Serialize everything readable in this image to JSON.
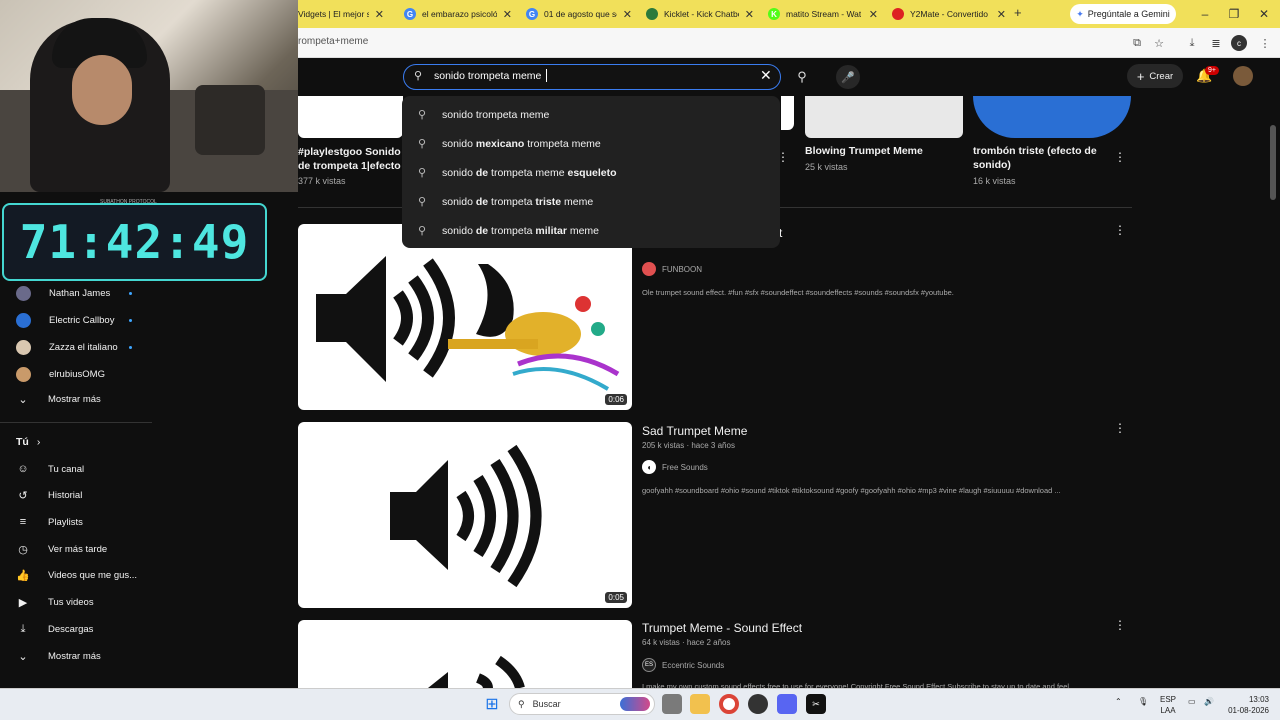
{
  "browser": {
    "tabs": [
      {
        "label": "Vidgets | El mejor so",
        "fav_color": "#e24",
        "fav": ""
      },
      {
        "label": "el embarazo psicológ",
        "fav_color": "#4285f4",
        "fav": "G"
      },
      {
        "label": "01 de agosto que se",
        "fav_color": "#4285f4",
        "fav": "G"
      },
      {
        "label": "Kicklet - Kick Chatbo",
        "fav_color": "#2b7a3b",
        "fav": ""
      },
      {
        "label": "matito Stream - Wat",
        "fav_color": "#53fc18",
        "fav": "K"
      },
      {
        "label": "Y2Mate - Convertido",
        "fav_color": "#d22",
        "fav": ""
      }
    ],
    "new_tab": "+",
    "gemini_label": "Pregúntale a Gemini",
    "url": "rompeta+meme"
  },
  "youtube": {
    "search_value": "sonido trompeta meme",
    "create_label": "Crear",
    "notif_badge": "9+",
    "suggestions": [
      {
        "pre": "sonido ",
        "bold": "",
        "post": "trompeta meme",
        "bold2": ""
      },
      {
        "pre": "sonido ",
        "bold": "mexicano",
        "post": " trompeta meme",
        "bold2": ""
      },
      {
        "pre": "sonido ",
        "bold": "de",
        "post": " trompeta meme ",
        "bold2": "esqueleto"
      },
      {
        "pre": "sonido ",
        "bold": "de",
        "post": " trompeta ",
        "bold2": "triste",
        "post2": " meme"
      },
      {
        "pre": "sonido ",
        "bold": "de",
        "post": " trompeta ",
        "bold2": "militar",
        "post2": " meme"
      }
    ],
    "shorts": [
      {
        "title": "#playlestgoo Sonido de trompeta 1|efecto de ...",
        "views": "377 k vistas"
      },
      {
        "title": "Blowing Trumpet Meme",
        "views": "25 k vistas"
      },
      {
        "title": "trombón triste (efecto de sonido)",
        "views": "16 k vistas"
      }
    ],
    "videos": [
      {
        "title": "t",
        "meta": "",
        "channel": "FUNBOON",
        "desc": "Ole trumpet sound effect. #fun #sfx #soundeffect #soundeffects #sounds #soundsfx #youtube.",
        "duration": "0:06",
        "chan_color": "#e05050"
      },
      {
        "title": "Sad Trumpet Meme",
        "meta": "205 k vistas · hace 3 años",
        "channel": "Free Sounds",
        "desc": "goofyahh #soundboard #ohio #sound #tiktok #tiktoksound #goofy #goofyahh #ohio #mp3 #vine #laugh #siuuuuu #download ...",
        "duration": "0:05",
        "chan_color": "#ffffff"
      },
      {
        "title": "Trumpet Meme - Sound Effect",
        "meta": "64 k vistas · hace 2 años",
        "channel": "Eccentric Sounds",
        "desc": "I make my own custom sound effects free to use for everyone! Copyright Free Sound Effect Subscribe to stay up to date and feel",
        "duration": "",
        "chan_color": "#222222"
      }
    ],
    "sidebar": {
      "subscriptions": [
        {
          "name": "Nathan James",
          "color": "#6a6a8a"
        },
        {
          "name": "Electric Callboy",
          "color": "#2a6fd4"
        },
        {
          "name": "Zazza el italiano",
          "color": "#d9c7b0"
        },
        {
          "name": "elrubiusOMG",
          "color": "#c99a6a"
        }
      ],
      "show_more_1": "Mostrar más",
      "you_label": "Tú",
      "you_items": [
        {
          "label": "Tu canal",
          "icon": "channel-icon",
          "glyph": "☺"
        },
        {
          "label": "Historial",
          "icon": "history-icon",
          "glyph": "↺"
        },
        {
          "label": "Playlists",
          "icon": "playlists-icon",
          "glyph": "≡"
        },
        {
          "label": "Ver más tarde",
          "icon": "clock-icon",
          "glyph": "◷"
        },
        {
          "label": "Videos que me gus...",
          "icon": "like-icon",
          "glyph": "👍"
        },
        {
          "label": "Tus videos",
          "icon": "video-icon",
          "glyph": "▶"
        },
        {
          "label": "Descargas",
          "icon": "download-icon",
          "glyph": "⤓"
        }
      ],
      "show_more_2": "Mostrar más"
    }
  },
  "stream_overlay": {
    "timer": "71:42:49",
    "timer_label": "SUBATHON PROTOCOL"
  },
  "taskbar": {
    "search_placeholder": "Buscar",
    "lang_top": "ESP",
    "lang_bottom": "LAA",
    "time": "13:03",
    "date": "01-08-2026"
  }
}
